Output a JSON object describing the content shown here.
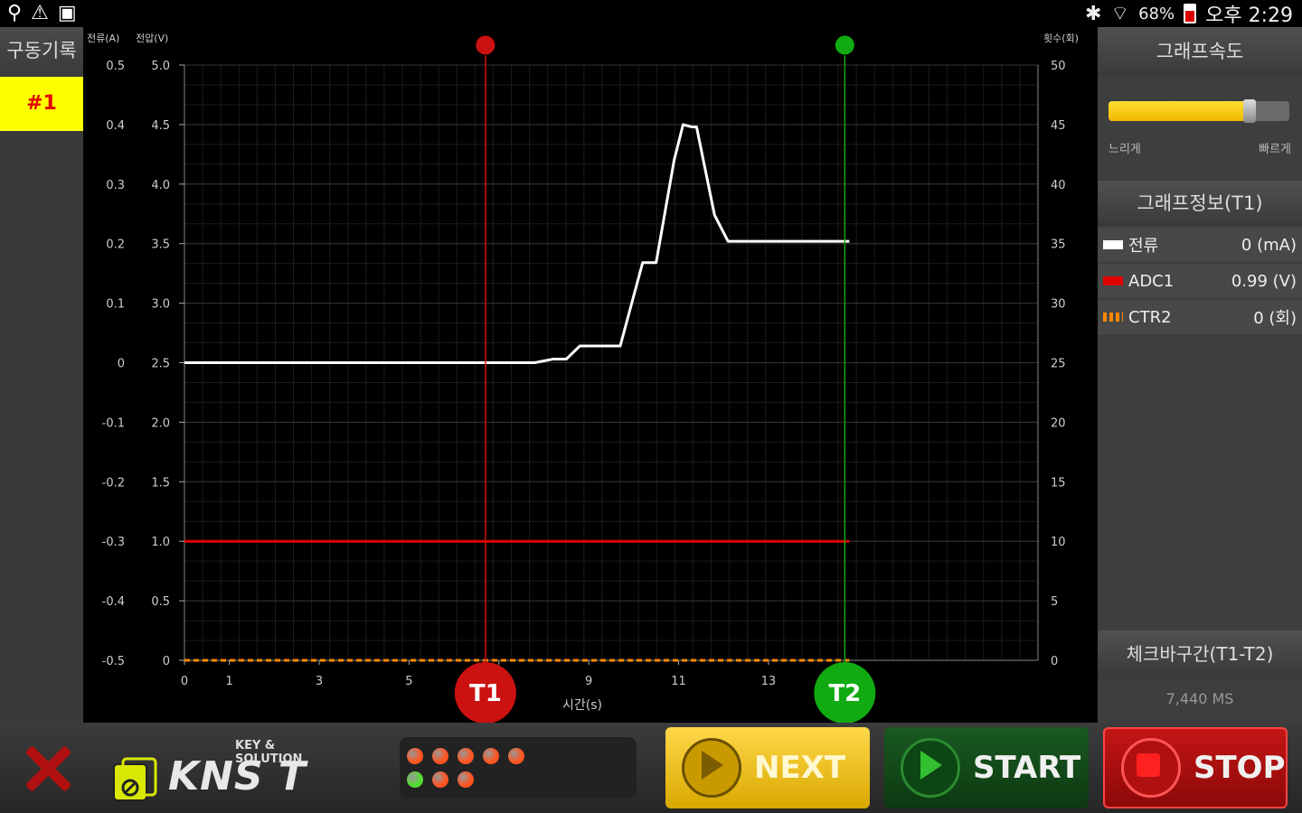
{
  "status_bar": {
    "icons_left": [
      "usb-icon",
      "warning-icon",
      "image-icon"
    ],
    "battery": "68%",
    "time": "오후 2:29"
  },
  "left_panel": {
    "title": "구동기록",
    "record_label": "#1"
  },
  "chart_data": {
    "type": "line",
    "left_axis_labels": {
      "current": "전류(A)",
      "voltage": "전압(V)"
    },
    "right_axis_label": "횟수(회)",
    "xlabel": "시간(s)",
    "x_ticks": [
      "0",
      "1",
      "3",
      "5",
      "7",
      "9",
      "11",
      "13"
    ],
    "x_tick_values": [
      0,
      1,
      3,
      5,
      7,
      9,
      11,
      13
    ],
    "xlim": [
      0,
      19
    ],
    "current_ticks": [
      "0.5",
      "0.4",
      "0.3",
      "0.2",
      "0.1",
      "0",
      "-0.1",
      "-0.2",
      "-0.3",
      "-0.4",
      "-0.5"
    ],
    "voltage_ticks": [
      "5.0",
      "4.5",
      "4.0",
      "3.5",
      "3.0",
      "2.5",
      "2.0",
      "1.5",
      "1.0",
      "0.5",
      "0"
    ],
    "count_ticks": [
      "50",
      "45",
      "40",
      "35",
      "30",
      "25",
      "20",
      "15",
      "10",
      "5",
      "0"
    ],
    "ylim_voltage": [
      0,
      5.0
    ],
    "grid": true,
    "series": [
      {
        "name": "전류",
        "color": "#ffffff",
        "x": [
          0,
          7.8,
          8.2,
          8.5,
          8.8,
          9.7,
          10.2,
          10.5,
          10.9,
          11.1,
          11.3,
          11.4,
          11.8,
          12.1,
          12.4,
          12.7,
          13.1,
          14.8
        ],
        "y": [
          2.5,
          2.5,
          2.53,
          2.53,
          2.64,
          2.64,
          3.34,
          3.34,
          4.2,
          4.5,
          4.48,
          4.48,
          3.74,
          3.52,
          3.52,
          3.52,
          3.52,
          3.52
        ]
      },
      {
        "name": "ADC1",
        "color": "#e00000",
        "x": [
          0,
          14.8
        ],
        "y": [
          1.0,
          1.0
        ]
      },
      {
        "name": "CTR2",
        "color": "#ff8800",
        "x": [
          0,
          14.8
        ],
        "y": [
          0,
          0
        ]
      }
    ],
    "markers": [
      {
        "label": "T1",
        "x": 6.7,
        "color": "#cc1111"
      },
      {
        "label": "T2",
        "x": 14.7,
        "color": "#11aa11"
      }
    ]
  },
  "right_panel": {
    "speed_title": "그래프속도",
    "speed_value": 0.78,
    "slow_label": "느리게",
    "fast_label": "빠르게",
    "info_title": "그래프정보(T1)",
    "legend": [
      {
        "name": "전류",
        "value": "0 (mA)",
        "color": "#ffffff"
      },
      {
        "name": "ADC1",
        "value": "0.99 (V)",
        "color": "#e00000"
      },
      {
        "name": "CTR2",
        "value": "0 (회)",
        "color": "#ff8800"
      }
    ],
    "check_title": "체크바구간(T1-T2)",
    "check_value": "7,440 MS"
  },
  "bottom_bar": {
    "logo_sub": "KEY & SOLUTION",
    "logo_main": "KNS T",
    "leds_row1": [
      "#ff5522",
      "#ff5522",
      "#ff5522",
      "#ff5522",
      "#ff5522"
    ],
    "leds_row2": [
      "#55dd33",
      "#ff5522",
      "#ff5522"
    ],
    "next_label": "NEXT",
    "start_label": "START",
    "stop_label": "STOP"
  }
}
